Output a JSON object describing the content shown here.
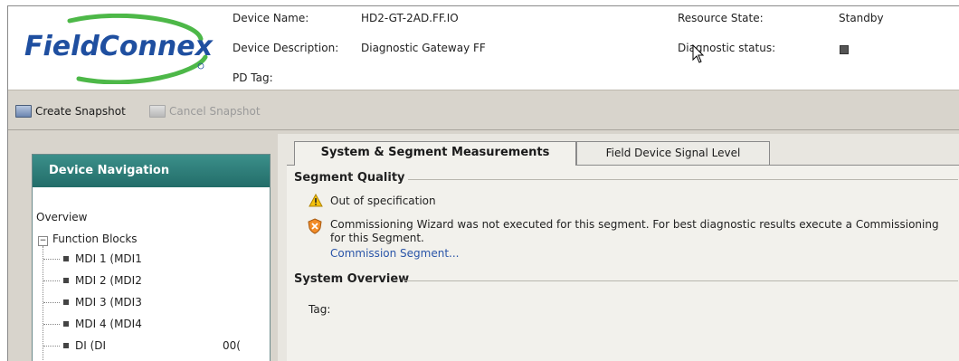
{
  "header": {
    "logo_text": "FieldConnex",
    "device_name_label": "Device Name:",
    "device_name_value": "HD2-GT-2AD.FF.IO",
    "device_description_label": "Device Description:",
    "device_description_value": "Diagnostic Gateway FF",
    "pd_tag_label": "PD Tag:",
    "resource_state_label": "Resource State:",
    "resource_state_value": "Standby",
    "diagnostic_status_label": "Diagnostic status:"
  },
  "toolbar": {
    "create_snapshot": "Create Snapshot",
    "cancel_snapshot": "Cancel Snapshot"
  },
  "navigation": {
    "title": "Device Navigation",
    "overview": "Overview",
    "function_blocks": "Function Blocks",
    "items": [
      {
        "label": "MDI 1 (MDI1"
      },
      {
        "label": "MDI 2 (MDI2"
      },
      {
        "label": "MDI 3 (MDI3"
      },
      {
        "label": "MDI 4 (MDI4"
      },
      {
        "label": "DI (DI",
        "suffix": "00("
      }
    ]
  },
  "tabs": [
    {
      "label": "System & Segment Measurements",
      "active": true
    },
    {
      "label": "Field Device Signal Level",
      "active": false
    }
  ],
  "segment_quality": {
    "title": "Segment Quality",
    "warning_text": "Out of specification",
    "wizard_text": "Commissioning Wizard was not executed for this segment. For best diagnostic results execute a Commissioning for this Segment.",
    "link_text": "Commission Segment..."
  },
  "system_overview": {
    "title": "System Overview",
    "tag_label": "Tag:"
  },
  "colors": {
    "logo_blue": "#1f4fa0",
    "logo_green": "#4db848",
    "nav_header": "#2b7d78",
    "link": "#2a55a8"
  }
}
